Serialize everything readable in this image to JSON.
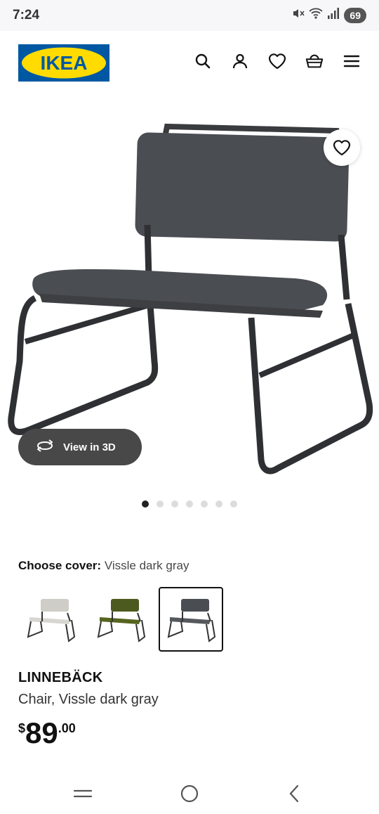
{
  "status_bar": {
    "time": "7:24",
    "battery": "69",
    "icons": [
      "mute-icon",
      "wifi-icon",
      "signal-icon"
    ]
  },
  "header": {
    "logo_text": "IKEA",
    "icons": [
      "search-icon",
      "user-icon",
      "heart-icon",
      "basket-icon",
      "menu-icon"
    ]
  },
  "gallery": {
    "view_3d_label": "View in 3D",
    "dot_count": 7,
    "active_dot": 0
  },
  "cover": {
    "label": "Choose cover:",
    "value": "Vissle dark gray",
    "options": [
      {
        "name": "light-gray",
        "color": "#cfcdc8"
      },
      {
        "name": "green",
        "color": "#4c5a1f"
      },
      {
        "name": "dark-gray",
        "color": "#4a4d52"
      }
    ],
    "selected_index": 2
  },
  "product": {
    "name": "LINNEBÄCK",
    "description": "Chair, Vissle dark gray",
    "price_currency": "$",
    "price_integer": "89",
    "price_decimal": ".00"
  },
  "colors": {
    "ikea_blue": "#0058a3",
    "ikea_yellow": "#ffdb00",
    "pill_bg": "#484848"
  }
}
